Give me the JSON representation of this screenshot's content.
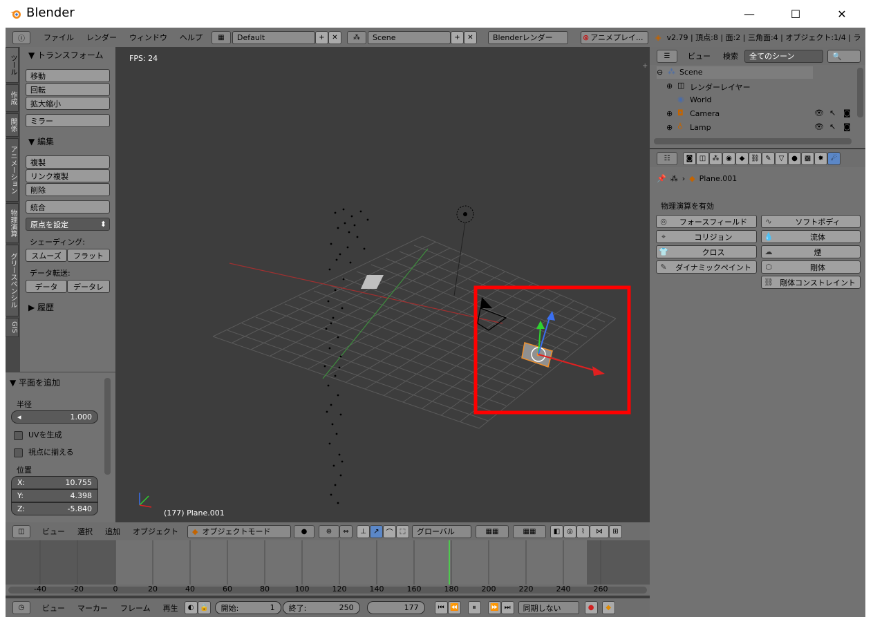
{
  "window": {
    "title": "Blender",
    "minimize": "—",
    "maximize": "☐",
    "close": "✕"
  },
  "topbar": {
    "menus": [
      "ファイル",
      "レンダー",
      "ウィンドウ",
      "ヘルプ"
    ],
    "layout": "Default",
    "scene": "Scene",
    "engine": "Blenderレンダー",
    "anim_play": "アニメプレイ...",
    "stats": "v2.79 | 頂点:8 | 面:2 | 三角面:4 | オブジェクト:1/4 | ラ"
  },
  "tool_tabs": [
    "ツール",
    "作成",
    "関係",
    "アニメーション",
    "物理演算",
    "グリースペンシル",
    "GIS"
  ],
  "toolshelf": {
    "transform_title": "トランスフォーム",
    "transform_buttons": [
      "移動",
      "回転",
      "拡大縮小"
    ],
    "mirror": "ミラー",
    "edit_title": "編集",
    "edit_buttons": [
      "複製",
      "リンク複製",
      "削除"
    ],
    "join": "統合",
    "origin": "原点を設定",
    "shading_label": "シェーディング:",
    "smooth": "スムーズ",
    "flat": "フラット",
    "data_transfer_label": "データ転送:",
    "data": "データ",
    "data2": "データレ",
    "history": "履歴"
  },
  "operator": {
    "title": "平面を追加",
    "radius_label": "半径",
    "radius_value": "1.000",
    "uv_label": "UVを生成",
    "align_label": "視点に揃える",
    "location_label": "位置",
    "x_label": "X:",
    "x_value": "10.755",
    "y_label": "Y:",
    "y_value": "4.398",
    "z_label": "Z:",
    "z_value": "-5.840"
  },
  "viewport": {
    "fps": "FPS: 24",
    "object_info": "(177) Plane.001"
  },
  "view3d_header": {
    "menus": [
      "ビュー",
      "選択",
      "追加",
      "オブジェクト"
    ],
    "mode": "オブジェクトモード",
    "orientation": "グローバル"
  },
  "timeline": {
    "ticks": [
      "-40",
      "-20",
      "0",
      "20",
      "40",
      "60",
      "80",
      "100",
      "120",
      "140",
      "160",
      "180",
      "200",
      "220",
      "240",
      "260"
    ],
    "menus": [
      "ビュー",
      "マーカー",
      "フレーム",
      "再生"
    ],
    "start_label": "開始:",
    "start_value": "1",
    "end_label": "終了:",
    "end_value": "250",
    "current_frame": "177",
    "sync": "同期しない"
  },
  "outliner": {
    "view": "ビュー",
    "search": "検索",
    "scene_filter": "全てのシーン",
    "items": [
      {
        "label": "Scene",
        "icon": "scene-icon"
      },
      {
        "label": "レンダーレイヤー",
        "icon": "render-layer-icon"
      },
      {
        "label": "World",
        "icon": "world-icon"
      },
      {
        "label": "Camera",
        "icon": "camera-icon"
      },
      {
        "label": "Lamp",
        "icon": "lamp-icon"
      }
    ]
  },
  "properties": {
    "object_name": "Plane.001",
    "physics_title": "物理演算を有効",
    "left_buttons": [
      "フォースフィールド",
      "コリジョン",
      "クロス",
      "ダイナミックペイント"
    ],
    "right_buttons": [
      "ソフトボディ",
      "流体",
      "煙",
      "剛体",
      "剛体コンストレイント"
    ]
  },
  "colors": {
    "highlight": "#ff0000",
    "accent": "#5b87c7",
    "frame_line": "#4ec94e"
  }
}
